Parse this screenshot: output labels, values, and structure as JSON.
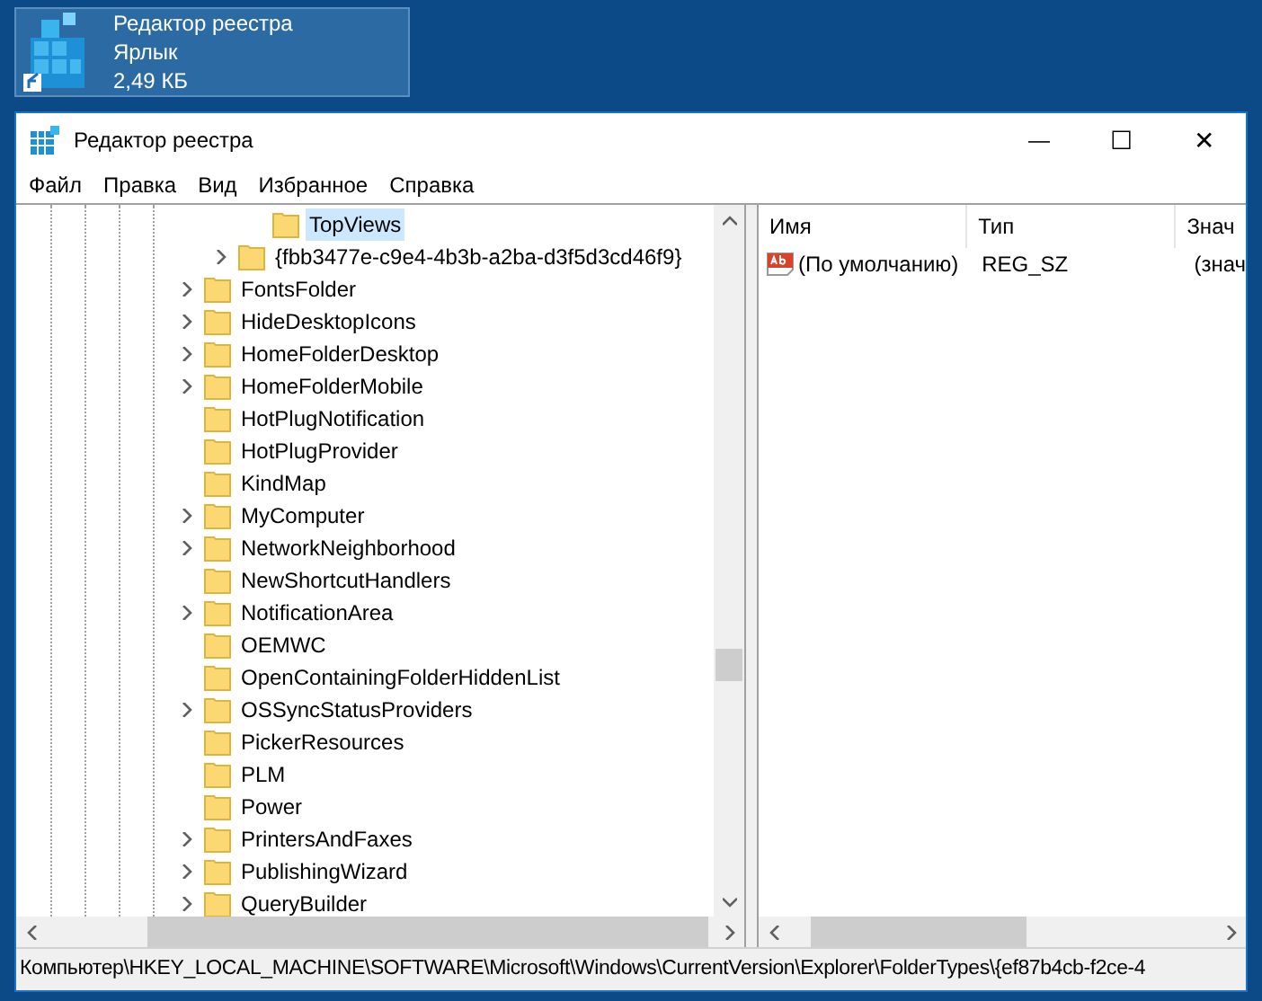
{
  "desktop_icon": {
    "title": "Редактор реестра",
    "type": "Ярлык",
    "size": "2,49 КБ",
    "selected": true
  },
  "window": {
    "title": "Редактор реестра",
    "minimize": "—",
    "maximize": "☐",
    "close": "✕"
  },
  "menu": [
    "Файл",
    "Правка",
    "Вид",
    "Избранное",
    "Справка"
  ],
  "tree": {
    "items": [
      {
        "children": [
          {
            "children": [
              {
                "label": "TopViews",
                "expandable": false,
                "selected": true
              }
            ]
          },
          {
            "label": "{fbb3477e-c9e4-4b3b-a2ba-d3f5d3cd46f9}",
            "expandable": true,
            "selected": false
          }
        ]
      },
      {
        "label": "FontsFolder",
        "expandable": true,
        "selected": false
      },
      {
        "label": "HideDesktopIcons",
        "expandable": true,
        "selected": false
      },
      {
        "label": "HomeFolderDesktop",
        "expandable": true,
        "selected": false
      },
      {
        "label": "HomeFolderMobile",
        "expandable": true,
        "selected": false
      },
      {
        "label": "HotPlugNotification",
        "expandable": false,
        "selected": false
      },
      {
        "label": "HotPlugProvider",
        "expandable": false,
        "selected": false
      },
      {
        "label": "KindMap",
        "expandable": false,
        "selected": false
      },
      {
        "label": "MyComputer",
        "expandable": true,
        "selected": false
      },
      {
        "label": "NetworkNeighborhood",
        "expandable": true,
        "selected": false
      },
      {
        "label": "NewShortcutHandlers",
        "expandable": false,
        "selected": false
      },
      {
        "label": "NotificationArea",
        "expandable": true,
        "selected": false
      },
      {
        "label": "OEMWC",
        "expandable": false,
        "selected": false
      },
      {
        "label": "OpenContainingFolderHiddenList",
        "expandable": false,
        "selected": false
      },
      {
        "label": "OSSyncStatusProviders",
        "expandable": true,
        "selected": false
      },
      {
        "label": "PickerResources",
        "expandable": false,
        "selected": false
      },
      {
        "label": "PLM",
        "expandable": false,
        "selected": false
      },
      {
        "label": "Power",
        "expandable": false,
        "selected": false
      },
      {
        "label": "PrintersAndFaxes",
        "expandable": true,
        "selected": false
      },
      {
        "label": "PublishingWizard",
        "expandable": true,
        "selected": false
      },
      {
        "label": "QueryBuilder",
        "expandable": true,
        "selected": false
      }
    ]
  },
  "values": {
    "columns": [
      "Имя",
      "Тип",
      "Знач"
    ],
    "rows": [
      {
        "name": "(По умолчанию)",
        "type": "REG_SZ",
        "data": "(знач"
      }
    ]
  },
  "status_bar": "Компьютер\\HKEY_LOCAL_MACHINE\\SOFTWARE\\Microsoft\\Windows\\CurrentVersion\\Explorer\\FolderTypes\\{ef87b4cb-f2ce-4"
}
